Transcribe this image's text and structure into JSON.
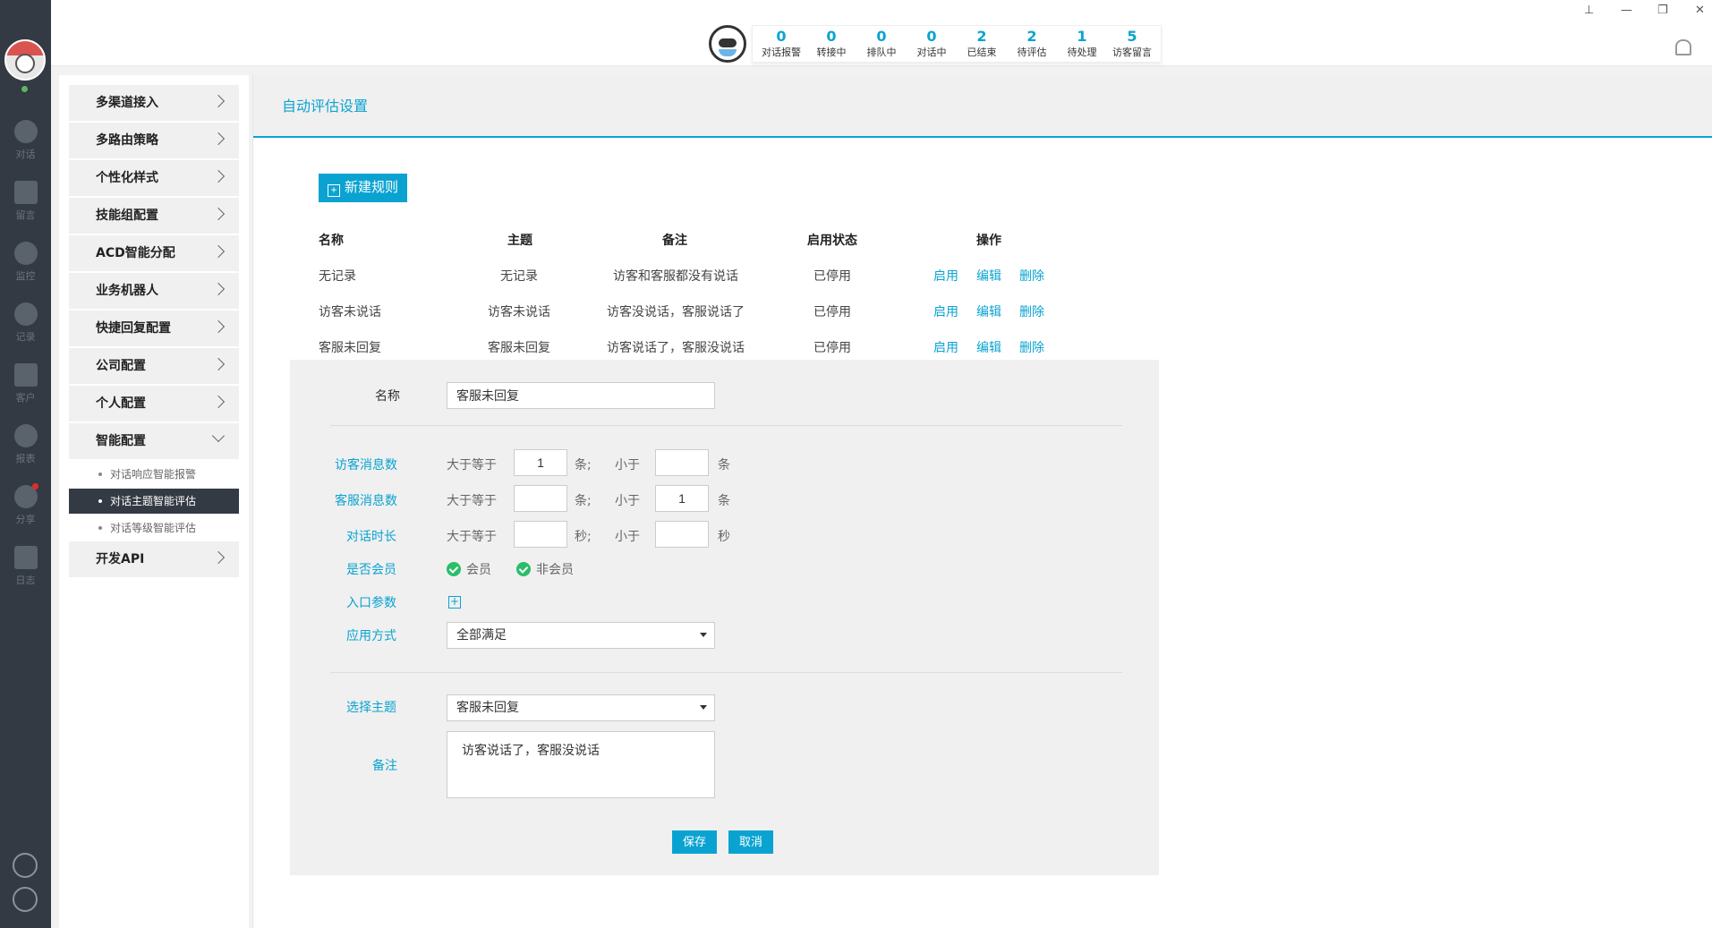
{
  "window": {
    "pin": "⊥",
    "minimize": "—",
    "restore": "❐",
    "close": "✕"
  },
  "rail": {
    "items": [
      {
        "label": "对话",
        "icon": "chat-icon"
      },
      {
        "label": "留言",
        "icon": "mail-icon"
      },
      {
        "label": "监控",
        "icon": "eye-icon"
      },
      {
        "label": "记录",
        "icon": "clock-icon"
      },
      {
        "label": "客户",
        "icon": "id-card-icon"
      },
      {
        "label": "报表",
        "icon": "pie-chart-icon"
      },
      {
        "label": "分享",
        "icon": "share-icon"
      },
      {
        "label": "日志",
        "icon": "clipboard-icon"
      }
    ]
  },
  "stats": [
    {
      "value": "0",
      "label": "对话报警"
    },
    {
      "value": "0",
      "label": "转接中"
    },
    {
      "value": "0",
      "label": "排队中"
    },
    {
      "value": "0",
      "label": "对话中"
    },
    {
      "value": "2",
      "label": "已结束"
    },
    {
      "value": "2",
      "label": "待评估"
    },
    {
      "value": "1",
      "label": "待处理"
    },
    {
      "value": "5",
      "label": "访客留言"
    }
  ],
  "sidebar": {
    "items": [
      {
        "label": "多渠道接入"
      },
      {
        "label": "多路由策略"
      },
      {
        "label": "个性化样式"
      },
      {
        "label": "技能组配置"
      },
      {
        "label": "ACD智能分配"
      },
      {
        "label": "业务机器人"
      },
      {
        "label": "快捷回复配置"
      },
      {
        "label": "公司配置"
      },
      {
        "label": "个人配置"
      },
      {
        "label": "智能配置"
      }
    ],
    "sub_items": [
      {
        "label": "对话响应智能报警"
      },
      {
        "label": "对话主题智能评估"
      },
      {
        "label": "对话等级智能评估"
      }
    ],
    "last_item": {
      "label": "开发API"
    }
  },
  "main": {
    "title": "自动评估设置",
    "new_rule": "新建规则",
    "columns": {
      "name": "名称",
      "topic": "主题",
      "note": "备注",
      "status": "启用状态",
      "ops": "操作"
    },
    "rows": [
      {
        "name": "无记录",
        "topic": "无记录",
        "note": "访客和客服都没有说话",
        "status": "已停用",
        "enable": "启用",
        "edit": "编辑",
        "delete": "删除"
      },
      {
        "name": "访客未说话",
        "topic": "访客未说话",
        "note": "访客没说话，客服说话了",
        "status": "已停用",
        "enable": "启用",
        "edit": "编辑",
        "delete": "删除"
      },
      {
        "name": "客服未回复",
        "topic": "客服未回复",
        "note": "访客说话了，客服没说话",
        "status": "已停用",
        "enable": "启用",
        "edit": "编辑",
        "delete": "删除"
      }
    ]
  },
  "form": {
    "name_label": "名称",
    "name_value": "客服未回复",
    "visitor_msg_label": "访客消息数",
    "agent_msg_label": "客服消息数",
    "duration_label": "对话时长",
    "gte": "大于等于",
    "lt": "小于",
    "unit_msg_sep": "条;",
    "unit_msg": "条",
    "unit_sec_sep": "秒;",
    "unit_sec": "秒",
    "visitor_min": "1",
    "visitor_max": "",
    "agent_min": "",
    "agent_max": "1",
    "duration_min": "",
    "duration_max": "",
    "member_label": "是否会员",
    "member_opt": "会员",
    "nonmember_opt": "非会员",
    "entry_label": "入口参数",
    "apply_label": "应用方式",
    "apply_value": "全部满足",
    "topic_label": "选择主题",
    "topic_value": "客服未回复",
    "note_label": "备注",
    "note_value": "访客说话了，客服没说话",
    "save": "保存",
    "cancel": "取消"
  },
  "colors": {
    "accent": "#0aa3d1",
    "rail": "#333a43",
    "check": "#2bbd6a"
  }
}
